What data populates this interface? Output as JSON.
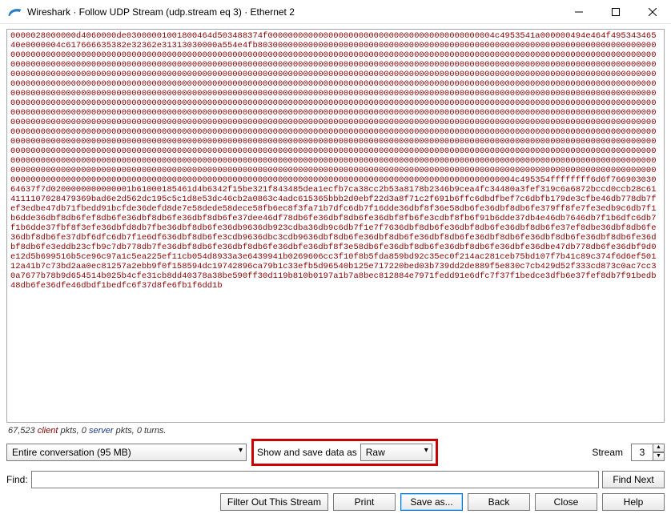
{
  "window": {
    "title": "Wireshark · Follow UDP Stream (udp.stream eq 3) · Ethernet 2"
  },
  "hex": "0000028000000d4060000de03000001001800464d503488374f000000000000000000000000000000000000000000004c4953541a000000494e464f49534346540e0000004c617666635382e32362e31313030000a554e4fb8030000000000000000000000000000000000000000000000000000000000000000000000000000000000000000000000000000000000000000000000000000000000000000000000000000000000000000000000000000000000000000000000000000000000000000000000000000000000000000000000000000000000000000000000000000000000000000000000000000000000000000000000000000000000000000000000000000000000000000000000000000000000000000000000000000000000000000000000000000000000000000000000000000000000000000000000000000000000000000000000000000000000000000000000000000000000000000000000000000000000000000000000000000000000000000000000000000000000000000000000000000000000000000000000000000000000000000000000000000000000000000000000000000000000000000000000000000000000000000000000000000000000000000000000000000000000000000000000000000000000000000000000000000000000000000000000000000000000000000000000000000000000000000000000000000000000000000000000000000000000000000000000000000000000000000000000000000000000000000000000000000000000000000000000000000000000000000000000000000000000000000000000000000000000000000000000000000000000000000000000000000000000000000000000000000000000000000000000000000000000000000000000000000000000000000000000000000000000000000000000000000000000000000000000000000000000000000000000000000000000000000000000000000000000000000000000000000000000000000000000000000000000000000000000000000000000000000000000000000000000000000000000000000000000000000000000000000000000000000000000000000000000000000000000000000000000000000000000000000000000000000000000000000000000000000000000000000000000000000000000000000000000000000000000000000000000000000000000000000000000000000000000000000000000000000000000000000000000000000000000000000000000000000000000000000000000000000000000000000000000000000000000000000000000000000000000000000000000000000000000000000000000000000000000000000000000000004c495354ffffffff6d6f76690303064637f7d0200000000000001b61000185461d4b6342f15be321f843485dea1ecfb7ca38cc2b53a8178b2346b9cea4fc34480a3fef319c6a6872bccd0ccb28c614111107028479369bad6e2d562dc195c5c1d8e53dc46cb2a0863c4adc615365bbb2d0ebf22d3a8f71c2f691b6ffc6dbdfbef7c6dbfb179de3cfbe46db778db7fef3edbe47db71fbedd91bcfde36defd8de7e58dede58dece58fb6ec8f3fa71b7dfc6db7f16dde36dbf8f36e58db6fe36dbf8db6fe379ff8fe7fe3edb9c6db7f1b6dde36dbf8db6fef8db6fe36dbf8db6fe36dbf8db6fe37dee46df78db6fe36dbf8db6fe36dbf8fb6fe3cdbf8fb6f91b6dde37db4e46db7646db7f1b6dfc6db7f1b6dde37fbf8f3efe36dbfd8db7fbe36dbf8db6fe36db9636db923cdba36db9c6db7f1e7f7636dbf8db6fe36dbf8db6fe36dbf8db6fe37ef8dbe36dbf8db6fe36dbf8db6fe37dbf6dfc6db7f1e6df636dbf8db6fe3cdb9636dbc3cdb9636dbf8db6fe36dbf8db6fe36dbf8db6fe36dbf8db6fe36dbf8db6fe36dbf8db6fe36dbf8db6fe3eddb23cfb9c7db778db7fe36dbf8db6fe36dbf8db6fe36dbfe36dbf8f3e58db6fe36dbf8db6fe36dbf8db6fe36dbfe36dbe47db778db6fe36dbf9d0e12d5b699516b5ce96c97a1c5ea225ef11cb054d8933a3e6439941b0269606cc3f10f8b5fda859bd92c35ec0f214ac281ceb75bd107f7b41c89c374f6d6ef50112a41b7c73bd2aa0ec81257a2ebb9f0f158594dc19742896ca79b1c33efb5d96540b125e717220bed03b739dd2de889f5e830c7cb429d52f333cd873c0ac7cc30a7677b78b9d654514b025b4cfe31cb8dd40378a38be590ff30d119b810b0197a1b7a8bec812884e7971fedd91e6dfc7f37f1bedce3dfb6e37fef8db7f91bedb48db6fe36dfe46dbdf1bedfc6f37d8fe6fb1f6dd1b",
  "stats": {
    "client_pkts": "67,523",
    "client_word": "client",
    "sep1": " pkts, ",
    "server_pkts": "0",
    "server_word": "server",
    "sep2": " pkts, ",
    "turns": "0 turns."
  },
  "controls": {
    "conversation": "Entire conversation (95 MB)",
    "show_save_label": "Show and save data as",
    "format": "Raw",
    "stream_label": "Stream",
    "stream_value": "3",
    "find_label": "Find:",
    "find_next": "Find Next"
  },
  "buttons": {
    "filter_out": "Filter Out This Stream",
    "print": "Print",
    "save_as": "Save as...",
    "back": "Back",
    "close": "Close",
    "help": "Help"
  }
}
